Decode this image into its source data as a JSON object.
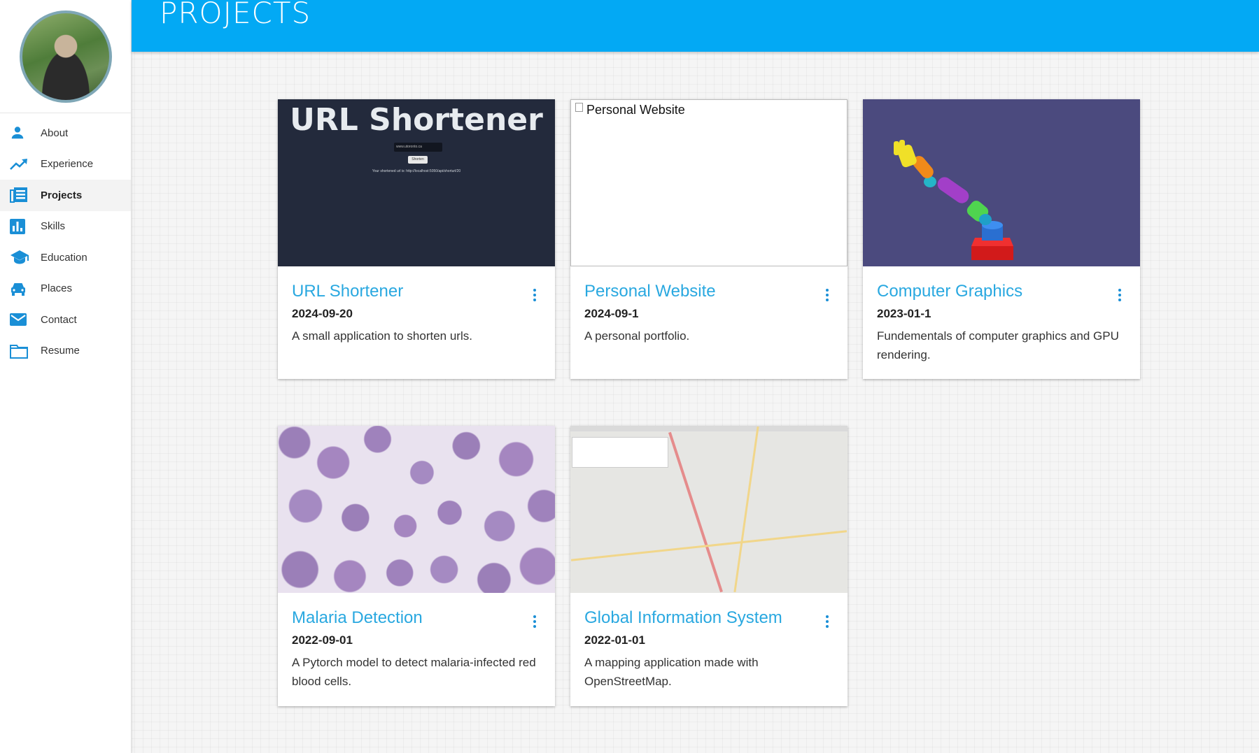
{
  "sidebar": {
    "items": [
      {
        "label": "About",
        "icon": "person-icon"
      },
      {
        "label": "Experience",
        "icon": "trending-up-icon"
      },
      {
        "label": "Projects",
        "icon": "news-icon",
        "active": true
      },
      {
        "label": "Skills",
        "icon": "bar-chart-icon"
      },
      {
        "label": "Education",
        "icon": "school-icon"
      },
      {
        "label": "Places",
        "icon": "car-icon"
      },
      {
        "label": "Contact",
        "icon": "mail-icon"
      },
      {
        "label": "Resume",
        "icon": "folder-icon"
      }
    ]
  },
  "header": {
    "title": "PROJECTS"
  },
  "colors": {
    "accent": "#03a9f4",
    "icon": "#1a8fd6",
    "title": "#29a8e0"
  },
  "projects": [
    {
      "title": "URL Shortener",
      "date": "2024-09-20",
      "description": "A small application to shorten urls.",
      "image": {
        "heading": "URL Shortener",
        "input_text": "www.utoronto.ca",
        "button_label": "Shorten",
        "result_text": "Your shortened url is: http://localhost:5050/api/shorturl/20"
      }
    },
    {
      "title": "Personal Website",
      "date": "2024-09-1",
      "description": "A personal portfolio.",
      "image": {
        "alt_text": "Personal Website"
      }
    },
    {
      "title": "Computer Graphics",
      "date": "2023-01-1",
      "description": "Fundementals of computer graphics and GPU rendering."
    },
    {
      "title": "Malaria Detection",
      "date": "2022-09-01",
      "description": "A Pytorch model to detect malaria-infected red blood cells."
    },
    {
      "title": "Global Information System",
      "date": "2022-01-01",
      "description": "A mapping application made with OpenStreetMap."
    }
  ]
}
